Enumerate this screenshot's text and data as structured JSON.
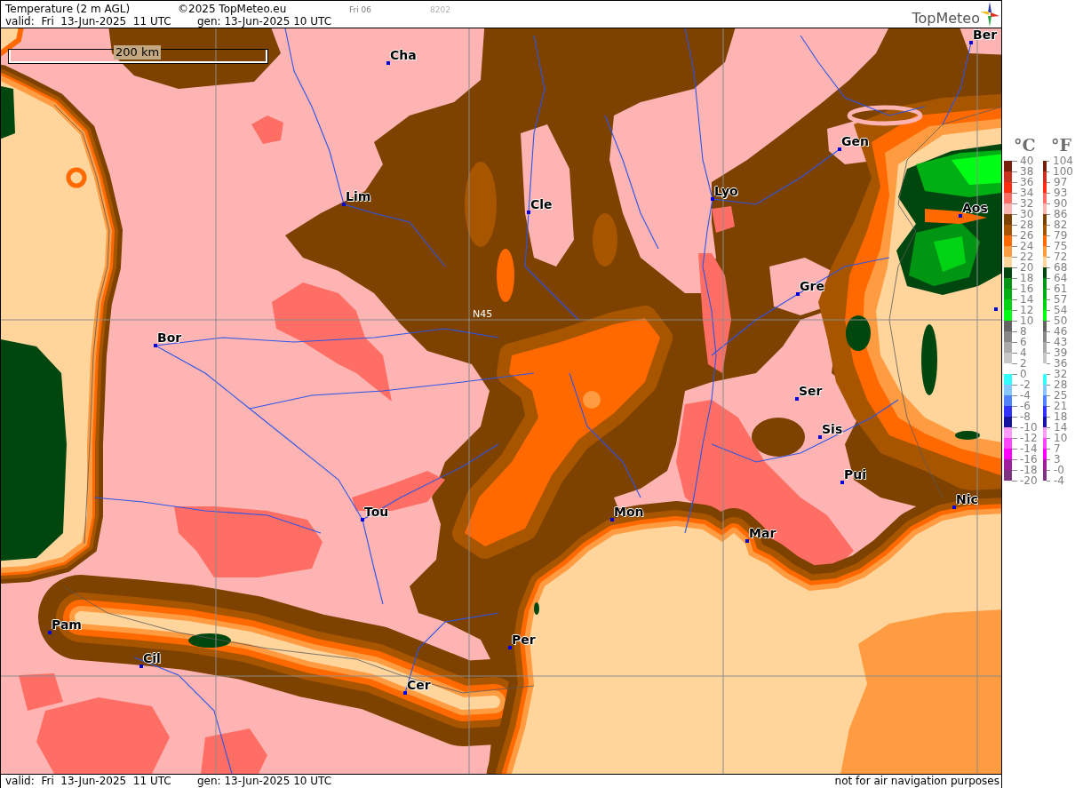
{
  "header": {
    "title": "Temperature (2 m AGL)",
    "copyright": "©2025 TopMeteo.eu",
    "run_label": "Fri 06",
    "code": "8202",
    "valid": "valid:  Fri  13-Jun-2025  11 UTC",
    "generated": "gen: 13-Jun-2025 10 UTC",
    "logo_text": "TopMeteo"
  },
  "map": {
    "scale_label": "200 km",
    "grid_label": "N45",
    "cities": [
      {
        "kind": "labelled",
        "name": "Ber"
      },
      {
        "kind": "labelled",
        "name": "Cha"
      },
      {
        "kind": "labelled",
        "name": "Gen"
      },
      {
        "kind": "labelled",
        "name": "Lyo"
      },
      {
        "kind": "labelled",
        "name": "Lim"
      },
      {
        "kind": "labelled",
        "name": "Cle"
      },
      {
        "kind": "labelled",
        "name": "Aos"
      },
      {
        "kind": "labelled",
        "name": "Gre"
      },
      {
        "kind": "marker"
      },
      {
        "kind": "labelled",
        "name": "Bor"
      },
      {
        "kind": "labelled",
        "name": "Ser"
      },
      {
        "kind": "labelled",
        "name": "Sis"
      },
      {
        "kind": "labelled",
        "name": "Pui"
      },
      {
        "kind": "labelled",
        "name": "Nic"
      },
      {
        "kind": "labelled",
        "name": "Mon"
      },
      {
        "kind": "labelled",
        "name": "Tou"
      },
      {
        "kind": "labelled",
        "name": "Mar"
      },
      {
        "kind": "labelled",
        "name": "Pam"
      },
      {
        "kind": "labelled",
        "name": "Per"
      },
      {
        "kind": "labelled",
        "name": "Cil"
      },
      {
        "kind": "labelled",
        "name": "Cer"
      }
    ]
  },
  "legend": {
    "celsius_title": "°C",
    "fahrenheit_title": "°F",
    "levels": [
      {
        "celsius": "40",
        "fahrenheit": "104",
        "color": "#781e0a"
      },
      {
        "celsius": "38",
        "fahrenheit": "100",
        "color": "#c8321e"
      },
      {
        "celsius": "36",
        "fahrenheit": "97",
        "color": "#ff2d0f"
      },
      {
        "celsius": "34",
        "fahrenheit": "93",
        "color": "#ff6e64"
      },
      {
        "celsius": "32",
        "fahrenheit": "90",
        "color": "#ffb4b4"
      },
      {
        "celsius": "30",
        "fahrenheit": "86",
        "color": "#7d4100"
      },
      {
        "celsius": "28",
        "fahrenheit": "82",
        "color": "#a85500"
      },
      {
        "celsius": "26",
        "fahrenheit": "79",
        "color": "#ff6900"
      },
      {
        "celsius": "24",
        "fahrenheit": "75",
        "color": "#ff9b41"
      },
      {
        "celsius": "22",
        "fahrenheit": "72",
        "color": "#ffd59b"
      },
      {
        "celsius": "20",
        "fahrenheit": "68",
        "color": "#00460f"
      },
      {
        "celsius": "18",
        "fahrenheit": "64",
        "color": "#009614"
      },
      {
        "celsius": "16",
        "fahrenheit": "61",
        "color": "#00af14"
      },
      {
        "celsius": "14",
        "fahrenheit": "57",
        "color": "#00d214"
      },
      {
        "celsius": "12",
        "fahrenheit": "54",
        "color": "#00ff14"
      },
      {
        "celsius": "10",
        "fahrenheit": "50",
        "color": "#646464"
      },
      {
        "celsius": "8",
        "fahrenheit": "46",
        "color": "#878787"
      },
      {
        "celsius": "6",
        "fahrenheit": "43",
        "color": "#aaaaaa"
      },
      {
        "celsius": "4",
        "fahrenheit": "39",
        "color": "#c8c8c8"
      },
      {
        "celsius": "2",
        "fahrenheit": "36"
      },
      {
        "celsius": "0",
        "fahrenheit": "32",
        "color": "#32ffff"
      },
      {
        "celsius": "-2",
        "fahrenheit": "28",
        "color": "#82c8ff"
      },
      {
        "celsius": "-4",
        "fahrenheit": "25",
        "color": "#5082ff"
      },
      {
        "celsius": "-6",
        "fahrenheit": "21",
        "color": "#3232ff"
      },
      {
        "celsius": "-8",
        "fahrenheit": "18",
        "color": "#1414a0"
      },
      {
        "celsius": "-10",
        "fahrenheit": "14",
        "color": "#ff9bff"
      },
      {
        "celsius": "-12",
        "fahrenheit": "10",
        "color": "#ff46ff"
      },
      {
        "celsius": "-14",
        "fahrenheit": "7",
        "color": "#ff00ff"
      },
      {
        "celsius": "-16",
        "fahrenheit": "3",
        "color": "#a01ea0"
      },
      {
        "celsius": "-18",
        "fahrenheit": "-0",
        "color": "#7d3282"
      },
      {
        "celsius": "-20",
        "fahrenheit": "-4"
      }
    ]
  },
  "footer": {
    "valid": "valid:  Fri  13-Jun-2025  11 UTC",
    "generated": "gen: 13-Jun-2025 10 UTC",
    "disclaimer": "not for air navigation purposes"
  }
}
